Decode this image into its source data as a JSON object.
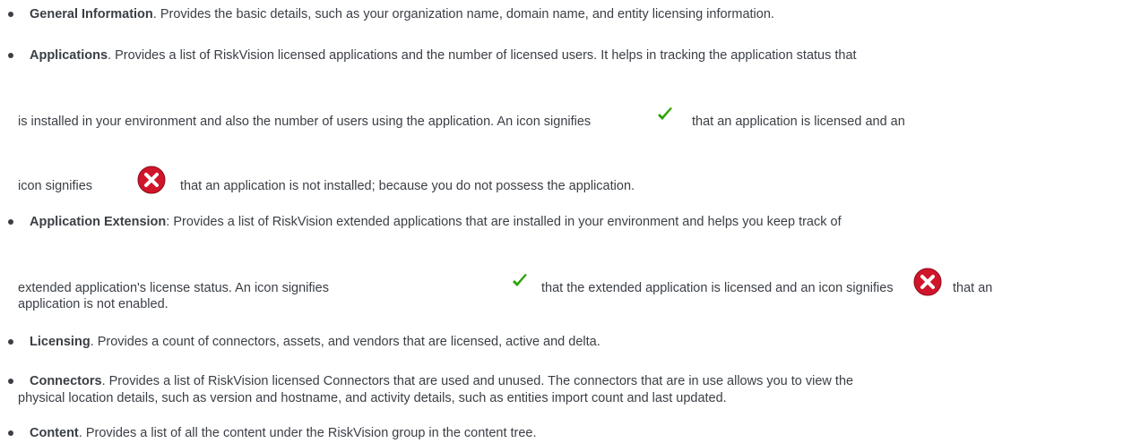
{
  "items": [
    {
      "term": "General Information",
      "lines": [
        ". Provides the basic details, such as your organization name, domain name, and entity licensing information."
      ]
    },
    {
      "term": "Applications",
      "lines": [
        ". Provides a list of RiskVision licensed applications and the number of licensed users. It helps in tracking the application status that",
        "is installed in your environment and also the number of users using the application. An icon signifies",
        "that an application is licensed and an",
        "icon signifies",
        "that an application is not installed; because you do not possess the application."
      ]
    },
    {
      "term": "Application Extension",
      "lines": [
        ": Provides a list of RiskVision extended applications that are installed in your environment and helps you keep track of",
        "extended application's license status. An icon signifies",
        "that the extended application is licensed and an icon signifies",
        "that an",
        "application is not enabled."
      ]
    },
    {
      "term": "Licensing",
      "lines": [
        ". Provides a count of connectors, assets, and vendors that are licensed, active and delta."
      ]
    },
    {
      "term": "Connectors",
      "lines": [
        ". Provides a list of RiskVision licensed Connectors that are used and unused. The connectors that are in use allows you to view the",
        "physical location details, such as version and hostname, and activity details, such as entities import count and last updated."
      ]
    },
    {
      "term": "Content",
      "lines": [
        ". Provides a list of all the content under the RiskVision group in the content tree."
      ]
    }
  ],
  "icons": {
    "licensed": "green-checkmark-icon",
    "not_installed": "red-x-circle-icon",
    "check_color": "#2aa300",
    "x_color": "#d0152b"
  }
}
